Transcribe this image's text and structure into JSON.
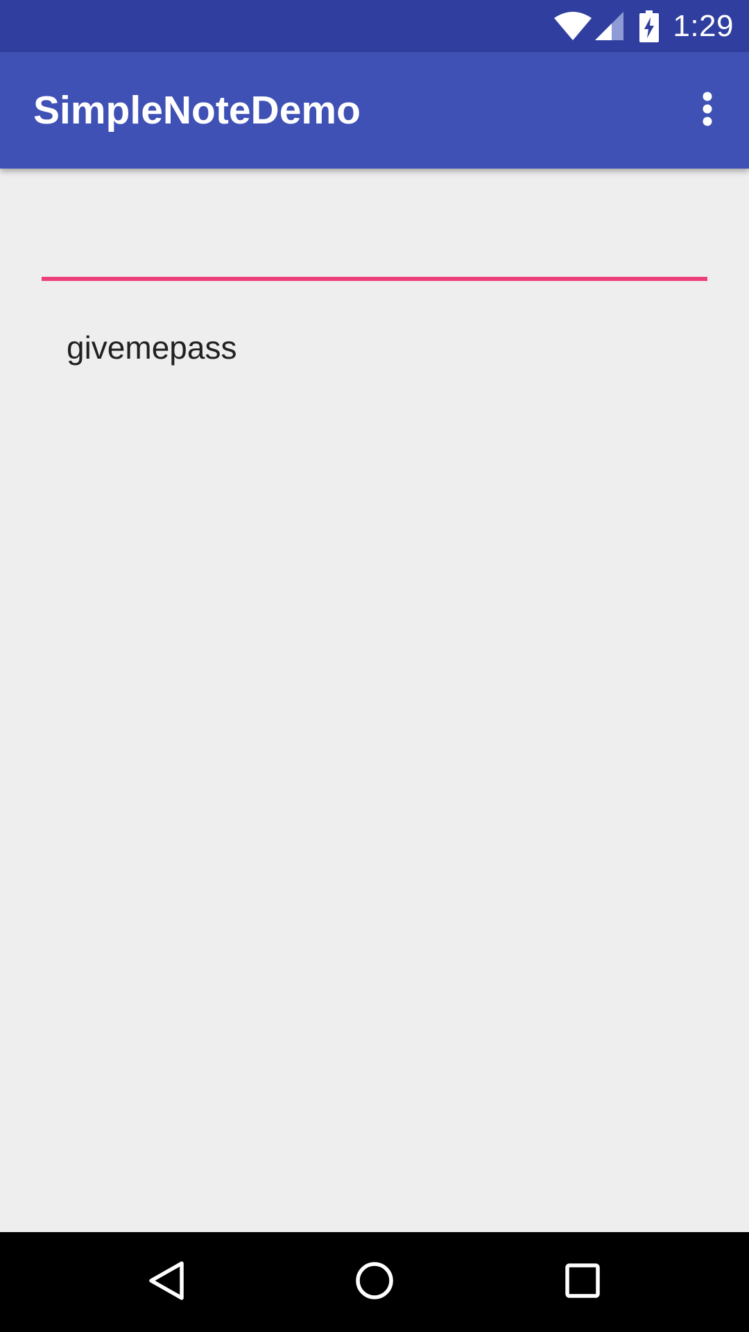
{
  "status_bar": {
    "time": "1:29",
    "background_color": "#303f9f",
    "icons": [
      "wifi-icon",
      "signal-icon",
      "battery-charging-icon"
    ]
  },
  "app_bar": {
    "title": "SimpleNoteDemo",
    "background_color": "#3f51b5",
    "menu_icon": "overflow-menu-icon"
  },
  "note_input": {
    "value": "",
    "accent_color": "#ec407a"
  },
  "notes": [
    {
      "text": "givemepass"
    }
  ],
  "nav_bar": {
    "buttons": [
      "back-icon",
      "home-icon",
      "recents-icon"
    ]
  }
}
